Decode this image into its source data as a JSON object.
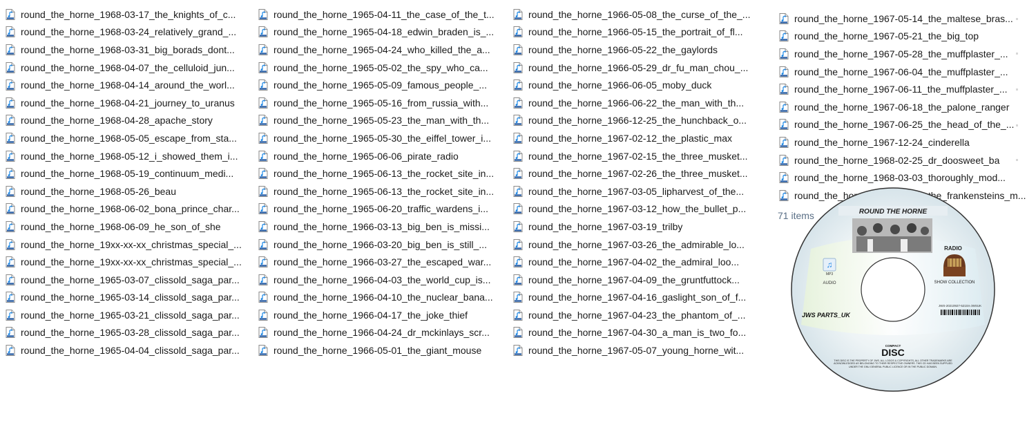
{
  "columns": [
    {
      "files": [
        "round_the_horne_1968-03-17_the_knights_of_c...",
        "round_the_horne_1968-03-24_relatively_grand_...",
        "round_the_horne_1968-03-31_big_borads_dont...",
        "round_the_horne_1968-04-07_the_celluloid_jun...",
        "round_the_horne_1968-04-14_around_the_worl...",
        "round_the_horne_1968-04-21_journey_to_uranus",
        "round_the_horne_1968-04-28_apache_story",
        "round_the_horne_1968-05-05_escape_from_sta...",
        "round_the_horne_1968-05-12_i_showed_them_i...",
        "round_the_horne_1968-05-19_continuum_medi...",
        "round_the_horne_1968-05-26_beau",
        "round_the_horne_1968-06-02_bona_prince_char...",
        "round_the_horne_1968-06-09_he_son_of_she",
        "round_the_horne_19xx-xx-xx_christmas_special_...",
        "round_the_horne_19xx-xx-xx_christmas_special_...",
        "round_the_horne_1965-03-07_clissold_saga_par...",
        "round_the_horne_1965-03-14_clissold_saga_par...",
        "round_the_horne_1965-03-21_clissold_saga_par...",
        "round_the_horne_1965-03-28_clissold_saga_par...",
        "round_the_horne_1965-04-04_clissold_saga_par..."
      ]
    },
    {
      "files": [
        "round_the_horne_1965-04-11_the_case_of_the_t...",
        "round_the_horne_1965-04-18_edwin_braden_is_...",
        "round_the_horne_1965-04-24_who_killed_the_a...",
        "round_the_horne_1965-05-02_the_spy_who_ca...",
        "round_the_horne_1965-05-09_famous_people_...",
        "round_the_horne_1965-05-16_from_russia_with...",
        "round_the_horne_1965-05-23_the_man_with_th...",
        "round_the_horne_1965-05-30_the_eiffel_tower_i...",
        "round_the_horne_1965-06-06_pirate_radio",
        "round_the_horne_1965-06-13_the_rocket_site_in...",
        "round_the_horne_1965-06-13_the_rocket_site_in...",
        "round_the_horne_1965-06-20_traffic_wardens_i...",
        "round_the_horne_1966-03-13_big_ben_is_missi...",
        "round_the_horne_1966-03-20_big_ben_is_still_...",
        "round_the_horne_1966-03-27_the_escaped_war...",
        "round_the_horne_1966-04-03_the_world_cup_is...",
        "round_the_horne_1966-04-10_the_nuclear_bana...",
        "round_the_horne_1966-04-17_the_joke_thief",
        "round_the_horne_1966-04-24_dr_mckinlays_scr...",
        "round_the_horne_1966-05-01_the_giant_mouse"
      ]
    },
    {
      "files": [
        "round_the_horne_1966-05-08_the_curse_of_the_...",
        "round_the_horne_1966-05-15_the_portrait_of_fl...",
        "round_the_horne_1966-05-22_the_gaylords",
        "round_the_horne_1966-05-29_dr_fu_man_chou_...",
        "round_the_horne_1966-06-05_moby_duck",
        "round_the_horne_1966-06-22_the_man_with_th...",
        "round_the_horne_1966-12-25_the_hunchback_o...",
        "round_the_horne_1967-02-12_the_plastic_max",
        "round_the_horne_1967-02-15_the_three_musket...",
        "round_the_horne_1967-02-26_the_three_musket...",
        "round_the_horne_1967-03-05_lipharvest_of_the...",
        "round_the_horne_1967-03-12_how_the_bullet_p...",
        "round_the_horne_1967-03-19_trilby",
        "round_the_horne_1967-03-26_the_admirable_lo...",
        "round_the_horne_1967-04-02_the_admiral_loo...",
        "round_the_horne_1967-04-09_the_gruntfuttock...",
        "round_the_horne_1967-04-16_gaslight_son_of_f...",
        "round_the_horne_1967-04-23_the_phantom_of_...",
        "round_the_horne_1967-04-30_a_man_is_two_fo...",
        "round_the_horne_1967-05-07_young_horne_wit..."
      ]
    },
    {
      "files": [
        "round_the_horne_1967-05-14_the_maltese_bras...",
        "round_the_horne_1967-05-21_the_big_top",
        "round_the_horne_1967-05-28_the_muffplaster_...",
        "round_the_horne_1967-06-04_the_muffplaster_...",
        "round_the_horne_1967-06-11_the_muffplaster_...",
        "round_the_horne_1967-06-18_the_palone_ranger",
        "round_the_horne_1967-06-25_the_head_of_the_...",
        "round_the_horne_1967-12-24_cinderella",
        "round_the_horne_1968-02-25_dr_doosweet_ba",
        "round_the_horne_1968-03-03_thoroughly_mod...",
        "round_the_horne_1968-03-10_the_frankensteins_m..."
      ]
    }
  ],
  "file_icon": "mp3-audio-file-icon",
  "status": {
    "items_count": "71 items"
  },
  "cd_label": {
    "title": "ROUND THE HORNE",
    "radio": "RADIO",
    "show_collection": "SHOW COLLECTION",
    "audio": "AUDIO",
    "mp3": "MP3",
    "brand": "JWS PARTS_UK",
    "catalog": "JWS-20210927-52104-JWSUK",
    "disc_logo": "DISC",
    "compact": "COMPACT",
    "disclaimer": "THIS DISC IS THE PROPERTY OF JWS. ALL LOGOS & COPYRIGHTS, ALL OTHER TRADEMARKS ARE ACKNOWLEDGED AS BELONGING TO THEIR RESPECTIVE OWNERS. THIS CD HAS BEEN SUPPLIED UNDER THE GNU GENERAL PUBLIC LICENCE OR IN THE PUBLIC DOMAIN."
  },
  "colors": {
    "text": "#1a1a1a",
    "status_text": "#5a6f86",
    "icon_accent": "#1e88e5"
  }
}
